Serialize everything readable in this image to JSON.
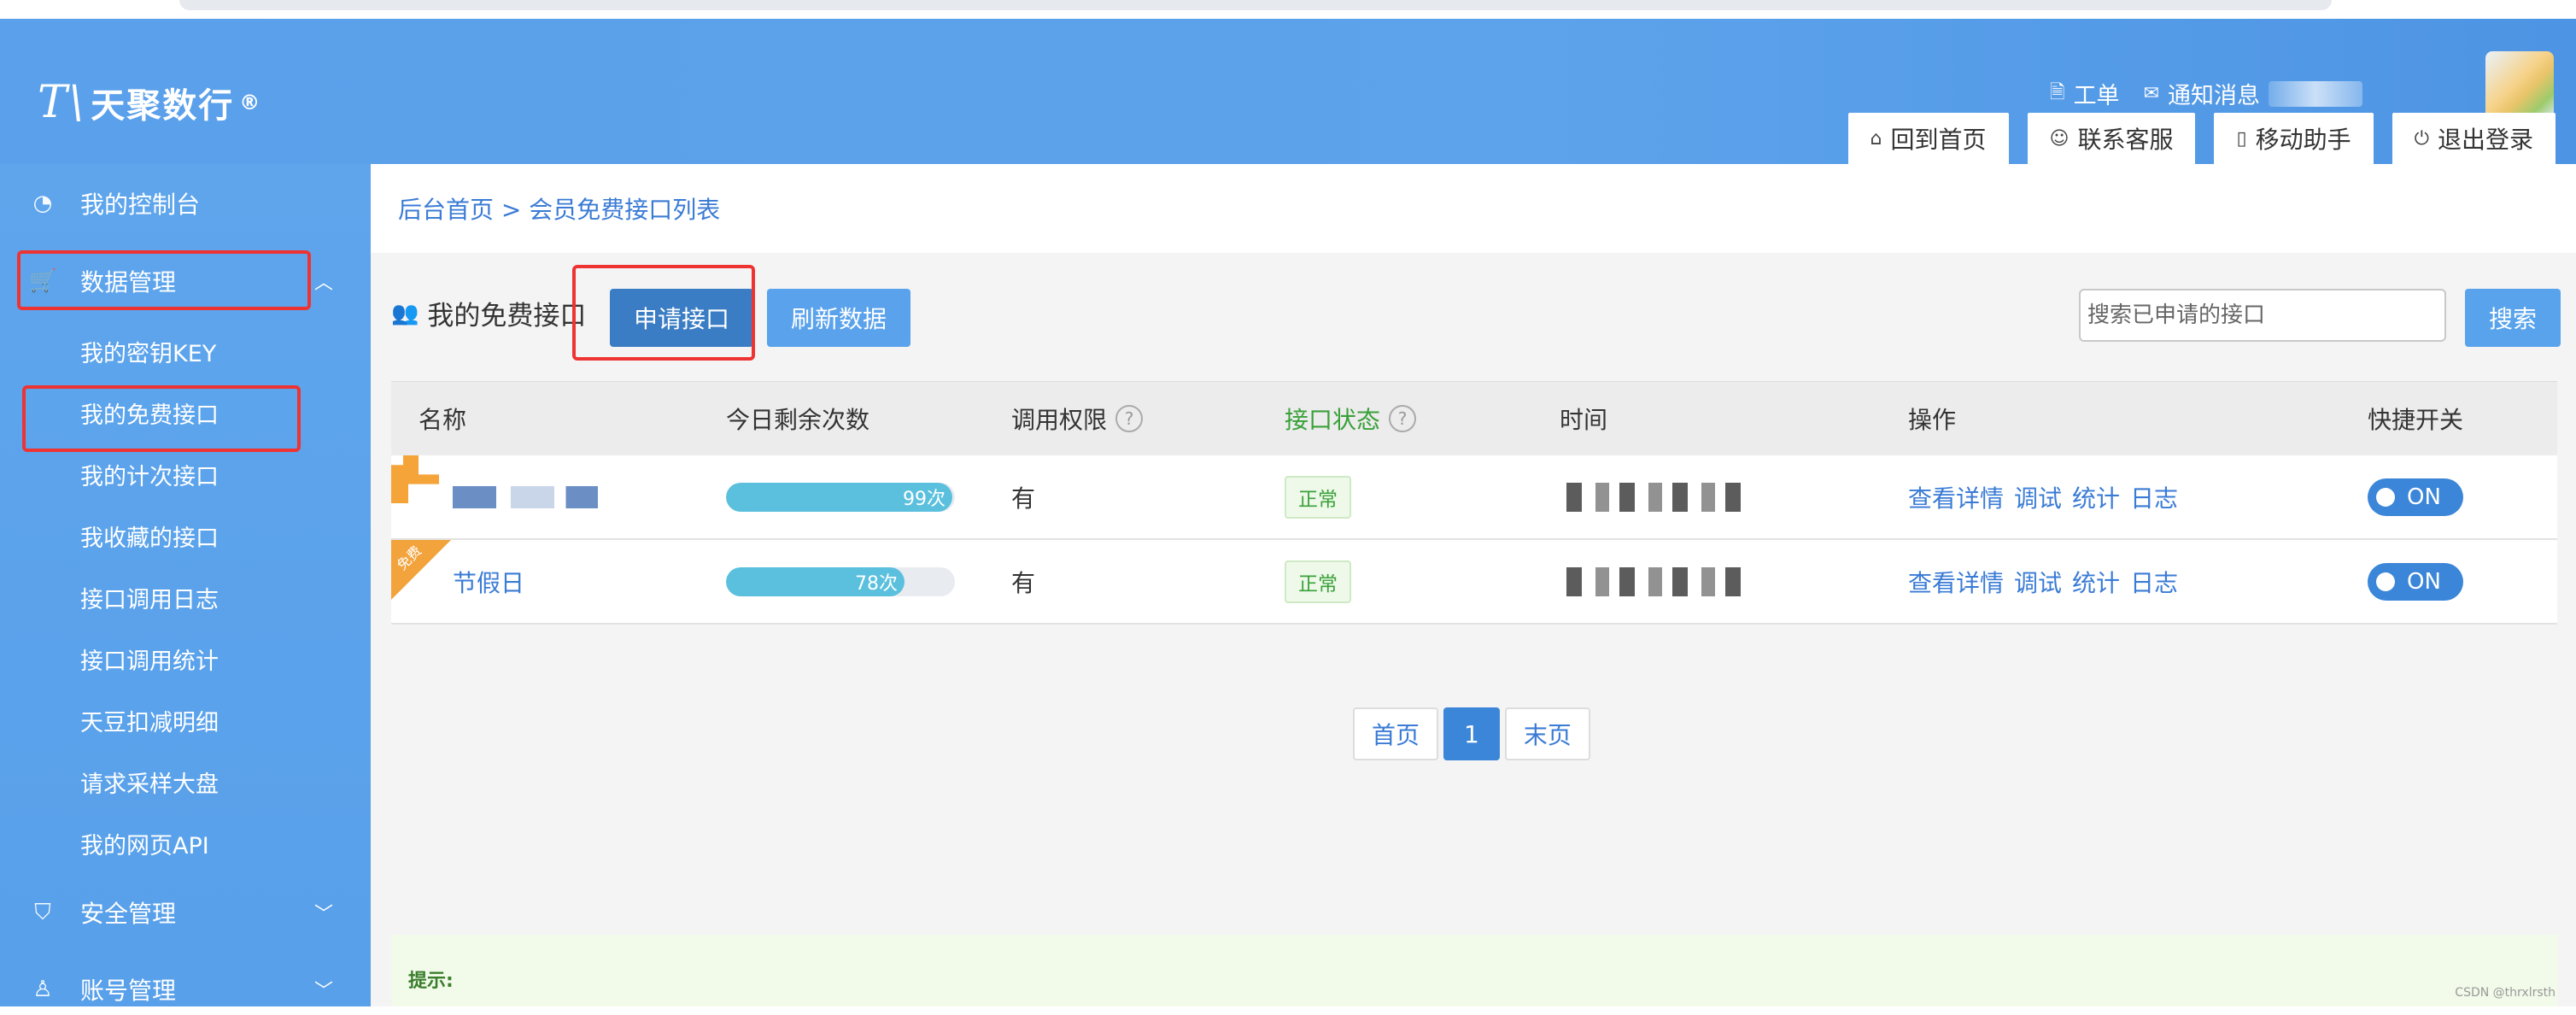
{
  "header": {
    "logo_mark": "T\\",
    "logo_text": "天聚数行",
    "logo_reg": "®",
    "links": [
      {
        "icon": "document-icon",
        "label": "工单"
      },
      {
        "icon": "mail-icon",
        "label": "通知消息"
      }
    ],
    "tabs": [
      {
        "icon": "home-icon",
        "label": "回到首页"
      },
      {
        "icon": "user-icon",
        "label": "联系客服"
      },
      {
        "icon": "phone-icon",
        "label": "移动助手"
      },
      {
        "icon": "power-icon",
        "label": "退出登录"
      }
    ]
  },
  "sidebar": {
    "sections": [
      {
        "icon": "dashboard-icon",
        "label": "我的控制台"
      },
      {
        "icon": "cart-icon",
        "label": "数据管理",
        "expanded": true
      },
      {
        "icon": "shield-icon",
        "label": "安全管理"
      },
      {
        "icon": "person-icon",
        "label": "账号管理"
      }
    ],
    "sub_items": [
      "我的密钥KEY",
      "我的免费接口",
      "我的计次接口",
      "我收藏的接口",
      "接口调用日志",
      "接口调用统计",
      "天豆扣减明细",
      "请求采样大盘",
      "我的网页API"
    ]
  },
  "main": {
    "breadcrumb": "后台首页 > 会员免费接口列表",
    "panel_title": "我的免费接口",
    "apply_button": "申请接口",
    "refresh_button": "刷新数据",
    "search_placeholder": "搜索已申请的接口",
    "search_button": "搜索",
    "table": {
      "columns": [
        "名称",
        "今日剩余次数",
        "调用权限",
        "接口状态",
        "时间",
        "操作",
        "快捷开关"
      ],
      "rows": [
        {
          "name": "",
          "remaining": "99次",
          "remaining_fraction": 0.99,
          "permission": "有",
          "status": "正常",
          "time": "",
          "ops": [
            "查看详情",
            "调试",
            "统计",
            "日志"
          ],
          "toggle": "ON"
        },
        {
          "name": "节假日",
          "ribbon": "免费",
          "remaining": "78次",
          "remaining_fraction": 0.78,
          "permission": "有",
          "status": "正常",
          "time": "",
          "ops": [
            "查看详情",
            "调试",
            "统计",
            "日志"
          ],
          "toggle": "ON"
        }
      ]
    },
    "pagination": {
      "first": "首页",
      "current": "1",
      "last": "末页"
    },
    "tips_label": "提示:"
  },
  "watermark": "CSDN @thrxlrsth",
  "colors": {
    "header_blue": "#5aa0ea",
    "sidebar_blue": "#5ea5ec",
    "link_blue": "#3a7bd5",
    "status_green": "#3aa13a",
    "highlight_red": "#e33"
  }
}
